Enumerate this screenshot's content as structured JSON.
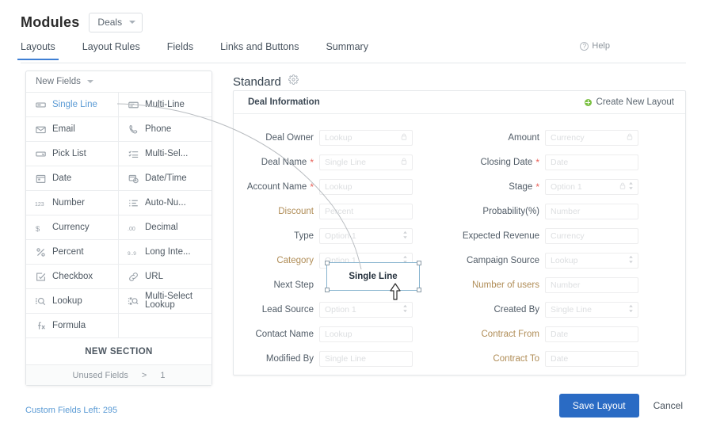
{
  "header": {
    "title": "Modules",
    "module_select": {
      "value": "Deals",
      "icon": "chevron-down-icon"
    },
    "tabs": [
      {
        "label": "Layouts",
        "active": true
      },
      {
        "label": "Layout Rules",
        "active": false
      },
      {
        "label": "Fields",
        "active": false
      },
      {
        "label": "Links and Buttons",
        "active": false
      },
      {
        "label": "Summary",
        "active": false
      }
    ],
    "help": {
      "label": "Help",
      "icon": "question-circle-icon"
    }
  },
  "sidebar": {
    "panel_title": "New Fields",
    "panel_caret": "chevron-down-icon",
    "fields": [
      {
        "label": "Single Line",
        "icon": "single-line-icon",
        "selected": true
      },
      {
        "label": "Multi-Line",
        "icon": "multi-line-icon",
        "selected": false
      },
      {
        "label": "Email",
        "icon": "email-icon",
        "selected": false
      },
      {
        "label": "Phone",
        "icon": "phone-icon",
        "selected": false
      },
      {
        "label": "Pick List",
        "icon": "pick-list-icon",
        "selected": false
      },
      {
        "label": "Multi-Sel...",
        "icon": "multi-select-icon",
        "selected": false
      },
      {
        "label": "Date",
        "icon": "date-icon",
        "selected": false
      },
      {
        "label": "Date/Time",
        "icon": "date-time-icon",
        "selected": false
      },
      {
        "label": "Number",
        "icon": "number-icon",
        "selected": false
      },
      {
        "label": "Auto-Nu...",
        "icon": "auto-number-icon",
        "selected": false
      },
      {
        "label": "Currency",
        "icon": "currency-icon",
        "selected": false
      },
      {
        "label": "Decimal",
        "icon": "decimal-icon",
        "selected": false
      },
      {
        "label": "Percent",
        "icon": "percent-icon",
        "selected": false
      },
      {
        "label": "Long Inte...",
        "icon": "long-integer-icon",
        "selected": false
      },
      {
        "label": "Checkbox",
        "icon": "checkbox-icon",
        "selected": false
      },
      {
        "label": "URL",
        "icon": "url-icon",
        "selected": false
      },
      {
        "label": "Lookup",
        "icon": "lookup-icon",
        "selected": false
      },
      {
        "label": "Multi-Select Lookup",
        "icon": "multi-select-lookup-icon",
        "selected": false
      },
      {
        "label": "Formula",
        "icon": "formula-icon",
        "selected": false
      },
      {
        "label": "",
        "icon": "",
        "selected": false
      }
    ],
    "new_section_label": "NEW SECTION",
    "unused_fields": {
      "label": "Unused Fields",
      "separator": ">",
      "count": "1"
    },
    "custom_fields_left": "Custom Fields Left: 295"
  },
  "layout": {
    "name": "Standard",
    "settings_icon": "gear-icon",
    "section_title": "Deal Information",
    "create_new_layout": {
      "label": "Create New Layout",
      "icon": "plus-circle-icon",
      "color": "#7bc043"
    },
    "left_column": [
      {
        "label": "Deal Owner",
        "required": false,
        "custom": false,
        "placeholder": "Lookup",
        "lock": true,
        "spinner": false
      },
      {
        "label": "Deal Name",
        "required": true,
        "custom": false,
        "placeholder": "Single Line",
        "lock": true,
        "spinner": false
      },
      {
        "label": "Account Name",
        "required": true,
        "custom": false,
        "placeholder": "Lookup",
        "lock": false,
        "spinner": false
      },
      {
        "label": "Discount",
        "required": false,
        "custom": true,
        "placeholder": "Percent",
        "lock": false,
        "spinner": false
      },
      {
        "label": "Type",
        "required": false,
        "custom": false,
        "placeholder": "Option 1",
        "lock": false,
        "spinner": true
      },
      {
        "label": "Category",
        "required": false,
        "custom": true,
        "placeholder": "Option 1",
        "lock": false,
        "spinner": true
      },
      {
        "label": "Next Step",
        "required": false,
        "custom": false,
        "placeholder": "",
        "lock": false,
        "spinner": false
      },
      {
        "label": "Lead Source",
        "required": false,
        "custom": false,
        "placeholder": "Option 1",
        "lock": false,
        "spinner": true
      },
      {
        "label": "Contact Name",
        "required": false,
        "custom": false,
        "placeholder": "Lookup",
        "lock": false,
        "spinner": false
      },
      {
        "label": "Modified By",
        "required": false,
        "custom": false,
        "placeholder": "Single Line",
        "lock": false,
        "spinner": false
      }
    ],
    "right_column": [
      {
        "label": "Amount",
        "required": false,
        "custom": false,
        "placeholder": "Currency",
        "lock": true,
        "spinner": false
      },
      {
        "label": "Closing Date",
        "required": true,
        "custom": false,
        "placeholder": "Date",
        "lock": false,
        "spinner": false
      },
      {
        "label": "Stage",
        "required": true,
        "custom": false,
        "placeholder": "Option 1",
        "lock": true,
        "spinner": true
      },
      {
        "label": "Probability(%)",
        "required": false,
        "custom": false,
        "placeholder": "Number",
        "lock": false,
        "spinner": false
      },
      {
        "label": "Expected Revenue",
        "required": false,
        "custom": false,
        "placeholder": "Currency",
        "lock": false,
        "spinner": false
      },
      {
        "label": "Campaign Source",
        "required": false,
        "custom": false,
        "placeholder": "Lookup",
        "lock": false,
        "spinner": true
      },
      {
        "label": "Number of users",
        "required": false,
        "custom": true,
        "placeholder": "Number",
        "lock": false,
        "spinner": false
      },
      {
        "label": "Created By",
        "required": false,
        "custom": false,
        "placeholder": "Single Line",
        "lock": false,
        "spinner": true
      },
      {
        "label": "Contract From",
        "required": false,
        "custom": true,
        "placeholder": "Date",
        "lock": false,
        "spinner": false
      },
      {
        "label": "Contract To",
        "required": false,
        "custom": true,
        "placeholder": "Date",
        "lock": false,
        "spinner": false
      }
    ],
    "dragged_field": {
      "label": "Single Line",
      "cursor": "arrow-cursor"
    }
  },
  "footer": {
    "save_label": "Save Layout",
    "cancel_label": "Cancel",
    "save_color": "#2a6bc4"
  }
}
